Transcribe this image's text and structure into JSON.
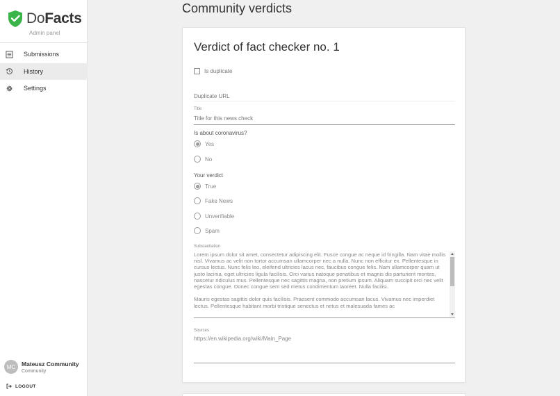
{
  "sidebar": {
    "logo_do": "Do",
    "logo_facts": "Facts",
    "logo_sub": "Admin panel",
    "items": [
      {
        "label": "Submissions",
        "icon": "list-icon"
      },
      {
        "label": "History",
        "icon": "history-icon",
        "active": true
      },
      {
        "label": "Settings",
        "icon": "gear-icon"
      }
    ],
    "user": {
      "initials": "MC",
      "name": "Mateusz Community",
      "role": "Community"
    },
    "logout": "LOGOUT"
  },
  "main": {
    "page_title": "Community verdicts",
    "card": {
      "title": "Verdict of fact checker no. 1",
      "duplicate_label": "Is duplicate",
      "duplicate_url_placeholder": "Duplicate URL",
      "title_label": "Title",
      "title_placeholder": "Title for this news check",
      "corona_label": "Is about coronavirus?",
      "corona_options": [
        "Yes",
        "No"
      ],
      "corona_selected": "Yes",
      "verdict_label": "Your verdict",
      "verdict_options": [
        "True",
        "Fake News",
        "Unverifiable",
        "Spam"
      ],
      "verdict_selected": "True",
      "substantiation_label": "Substantiation",
      "substantiation": "Lorem ipsum dolor sit amet, consectetur adipiscing elit. Fusce congue ac neque id fringilla. Nam vitae mollis nisl. Vivamus ac velit non tortor accumsan ullamcorper nec a nulla. Nunc non efficitur ex. Pellentesque in cursus lectus. Nunc felis leo, eleifend ultricies lacus nec, faucibus congue felis. Nam ullamcorper quam ut justo lacinia, eget ultricies ligula facilisis. Orci varius natoque penatibus et magnis dis parturient montes, nascetur ridiculus mus. Pellentesque nec sagittis magna, non pretium ipsum. Aliquam suscipit orci nec velit egestas congue. Donec congue sem sed metus condimentum laoreet. Nulla facilisi.\n\nMauris egestas sagittis dolor quis facilisis. Praesent commodo accumsan lacus. Vivamus nec imperdiet lectus. Pellentesque habitant morbi tristique senectus et netus et malesuada fames ac",
      "sources_label": "Sources",
      "sources": "https://en.wikipedia.org/wiki/Main_Page"
    }
  },
  "colors": {
    "brand_green": "#3bb54a",
    "active_nav": "#ebebeb"
  }
}
